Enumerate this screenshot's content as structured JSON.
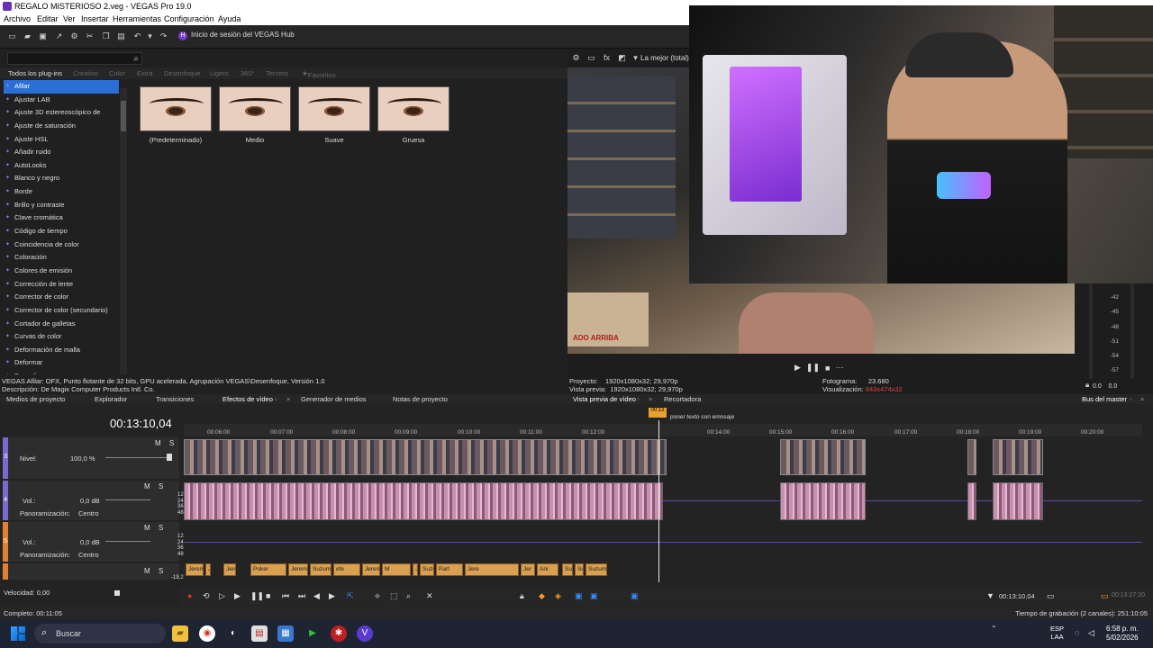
{
  "window": {
    "title": "REGALO MISTERIOSO 2.veg - VEGAS Pro 19.0"
  },
  "menu": [
    "Archivo",
    "Editar",
    "Ver",
    "Insertar",
    "Herramientas",
    "Configuración",
    "Ayuda"
  ],
  "toolbar": {
    "hub_label": "Inicio de sesión del VEGAS Hub"
  },
  "plugins": {
    "tabs": [
      "Todos los plug-ins",
      "Creativo",
      "Color",
      "Extra",
      "Desenfoque",
      "Ligero",
      "360°",
      "Tercero",
      "Favoritos"
    ],
    "items": [
      "Afilar",
      "Ajustar LAB",
      "Ajuste 3D estereoscópico de",
      "Ajuste de saturación",
      "Ajuste HSL",
      "Añadir ruido",
      "AutoLooks",
      "Blanco y negro",
      "Borde",
      "Brillo y contraste",
      "Clave cromática",
      "Código de tiempo",
      "Coincidencia de color",
      "Coloración",
      "Colores de emisión",
      "Corrección de lente",
      "Corrector de color",
      "Corrector de color (secundario)",
      "Cortador de galletas",
      "Curvas de color",
      "Deformación de malla",
      "Deformar",
      "Desenfoque"
    ],
    "presets": [
      "(Predeterminado)",
      "Medio",
      "Suave",
      "Gruesa"
    ],
    "desc_line1": "VEGAS Afilar: OFX, Punto flotante de 32 bits, GPU acelerada, Agrupación VEGAS\\Desenfoque, Versión 1.0",
    "desc_line2": "Descripción: De Magix Computer Products Intl. Co."
  },
  "preview": {
    "quality": "La mejor (total)",
    "overlay_text": "ADO ARRIBA",
    "proyecto_label": "Proyecto:",
    "proyecto_value": "1920x1080x32; 29,970p",
    "vista_label": "Vista previa:",
    "vista_value": "1920x1080x32; 29,970p",
    "fotograma_label": "Fotograma:",
    "fotograma_value": "23.680",
    "visual_label": "Visualización:",
    "visual_value": "843x474x32"
  },
  "master": {
    "scale": [
      "-42",
      "-45",
      "-48",
      "-51",
      "-54",
      "-57"
    ],
    "val_left": "0.0",
    "val_right": "0.0"
  },
  "dock_tabs": [
    "Medios de proyecto",
    "Explorador",
    "Transiciones",
    "Efectos de vídeo",
    "Generador de medios",
    "Notas de proyecto",
    "Vista previa de vídeo",
    "Recortadora",
    "Bus del master"
  ],
  "timeline": {
    "timecode": "00:13:10,04",
    "ruler": [
      "00:06:00",
      "00:07:00",
      "00:08:00",
      "00:09:00",
      "00:10:00",
      "00:11:00",
      "00:12:00",
      "00:14:00",
      "00:15:00",
      "00:16:00",
      "00:17:00",
      "00:18:00",
      "00:19:00",
      "00:20:00"
    ],
    "marker_label": "poner texto con emnsaje",
    "marker_time": "00:13",
    "track3": {
      "num": "3",
      "level_label": "Nivel:",
      "level_value": "100,0 %"
    },
    "track4": {
      "num": "4",
      "vol_label": "Vol.:",
      "vol_value": "0,0 dB",
      "pan_label": "Panoramización:",
      "pan_value": "Centro",
      "scale": [
        "12",
        "24",
        "36",
        "48"
      ]
    },
    "track5": {
      "num": "5",
      "vol_label": "Vol.:",
      "vol_value": "0,0 dB",
      "pan_label": "Panoramización:",
      "pan_value": "Centro",
      "scale": [
        "12",
        "24",
        "36",
        "48"
      ]
    },
    "text_clips": [
      "Jerem",
      "Jer",
      "Jeremy B M",
      "Poker",
      "Jeremy",
      "Suzumiya",
      "efe",
      "Jeremy E",
      "M",
      "Jeremy",
      "Suzumiya Haruhi OST - Itsumo",
      "Part",
      "Jere",
      "Jer",
      "Ani",
      "Suzumi",
      "Suzu",
      "Suzumi"
    ],
    "speed_label": "Velocidad: 0,00",
    "track6_db": "-19,2",
    "transport_time": "00:13:10,04",
    "transport_time_right": "00:13:27:20"
  },
  "status": {
    "left": "Completo: 00:11:05",
    "right": "Tiempo de grabación (2 canales): 251:10:05"
  },
  "taskbar": {
    "search": "Buscar",
    "lang1": "ESP",
    "lang2": "LAA",
    "time": "6:58 p. m.",
    "date": "5/02/2026"
  },
  "colors": {
    "accent": "#2b6fd6",
    "track_purple": "#7a6ad0",
    "marker_orange": "#e8a030",
    "hub_purple": "#7a3bc8"
  }
}
